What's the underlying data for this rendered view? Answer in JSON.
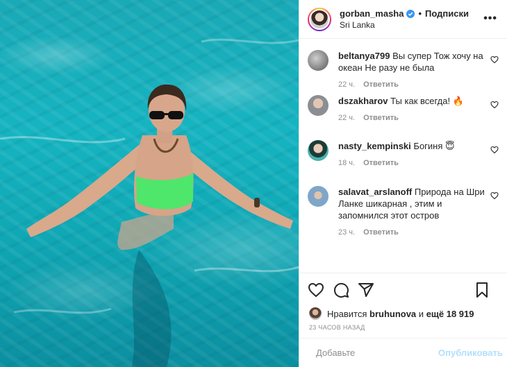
{
  "post": {
    "username": "gorban_masha",
    "follow_label": "Подписки",
    "location": "Sri Lanka",
    "more_label": "•••"
  },
  "comments": [
    {
      "user": "beltanya799",
      "text": "Вы супер Тож хочу на океан Не разу не была",
      "time": "22 ч.",
      "reply": "Ответить",
      "avatar_color": "#6f6f6f"
    },
    {
      "user": "dszakharov",
      "text": "Ты как всегда! 🔥",
      "time": "22 ч.",
      "reply": "Ответить",
      "avatar_color": "#9aa3a8"
    },
    {
      "user": "nasty_kempinski",
      "text": "Богиня 😇",
      "time": "18 ч.",
      "reply": "Ответить",
      "avatar_color": "#3f8f8f"
    },
    {
      "user": "salavat_arslanoff",
      "text": "Природа на Шри Ланке шикарная , этим и запомнился этот остров",
      "time": "23 ч.",
      "reply": "Ответить",
      "avatar_color": "#7a8fb0"
    }
  ],
  "likes": {
    "prefix": "Нравится",
    "user": "bruhunova",
    "middle": "и",
    "others": "ещё 18 919"
  },
  "time_ago": "23 ЧАСОВ НАЗАД",
  "comment_box": {
    "placeholder": "Добавьте",
    "publish_label": "Опубликовать"
  },
  "colors": {
    "verified": "#3897f0",
    "publish": "#b2dffc",
    "water": "#16b4c1",
    "swimsuit": "#4ee66b"
  }
}
